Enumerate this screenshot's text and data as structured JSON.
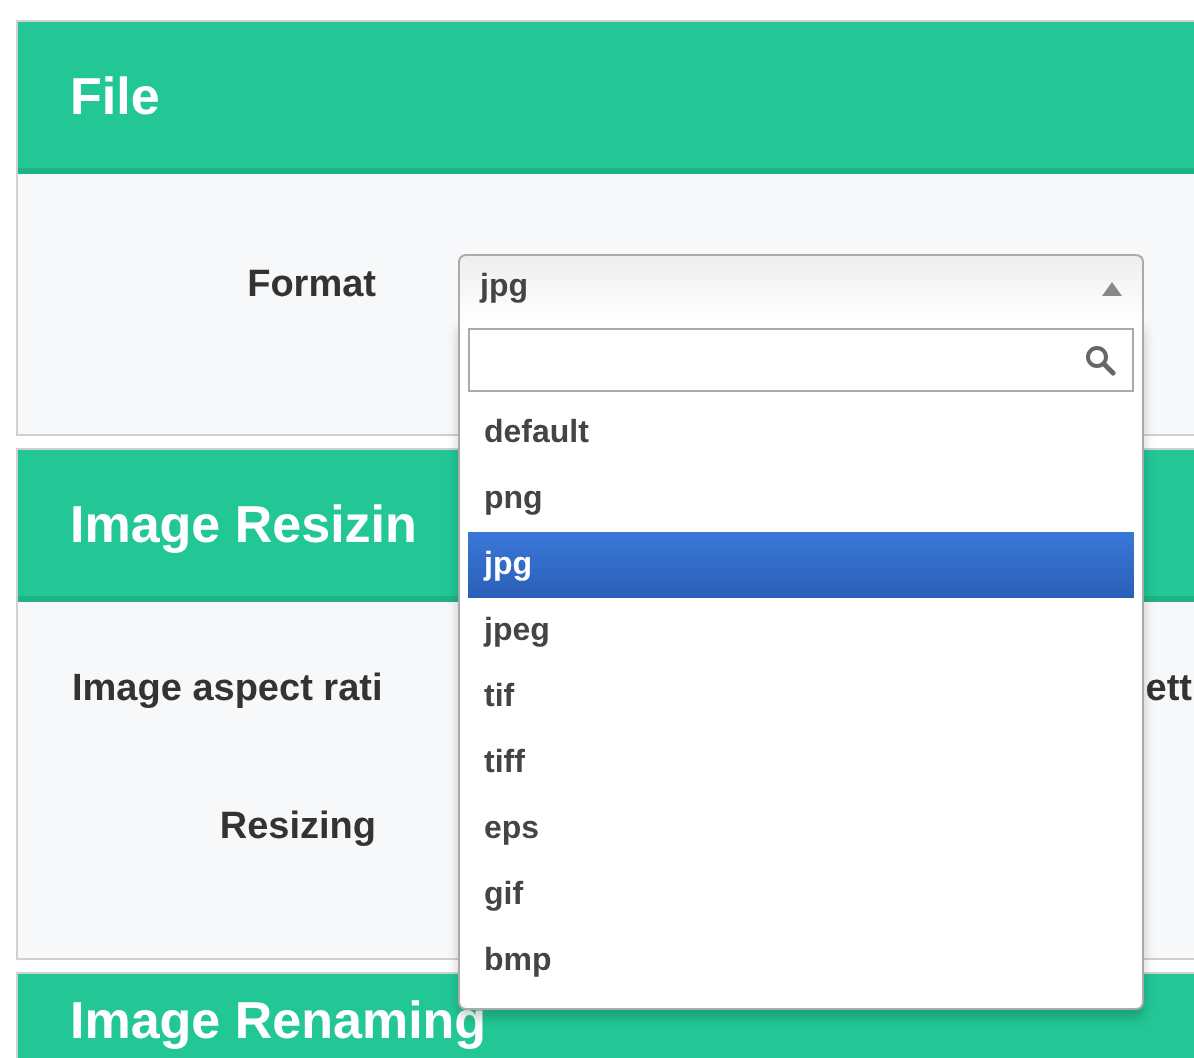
{
  "panels": [
    {
      "title": "File",
      "fields": [
        {
          "label": "Format",
          "kind": "select"
        }
      ]
    },
    {
      "title": "Image Resizin",
      "fields": [
        {
          "label": "Image aspect rati",
          "kind": "wide",
          "trailing": "ett"
        },
        {
          "label": "Resizing",
          "kind": "plain"
        }
      ]
    },
    {
      "title": "Image Renaming"
    }
  ],
  "format_select": {
    "value": "jpg",
    "expanded": true,
    "options": [
      {
        "label": "default",
        "selected": false
      },
      {
        "label": "png",
        "selected": false
      },
      {
        "label": "jpg",
        "selected": true
      },
      {
        "label": "jpeg",
        "selected": false
      },
      {
        "label": "tif",
        "selected": false
      },
      {
        "label": "tiff",
        "selected": false
      },
      {
        "label": "eps",
        "selected": false
      },
      {
        "label": "gif",
        "selected": false
      },
      {
        "label": "bmp",
        "selected": false
      }
    ]
  }
}
